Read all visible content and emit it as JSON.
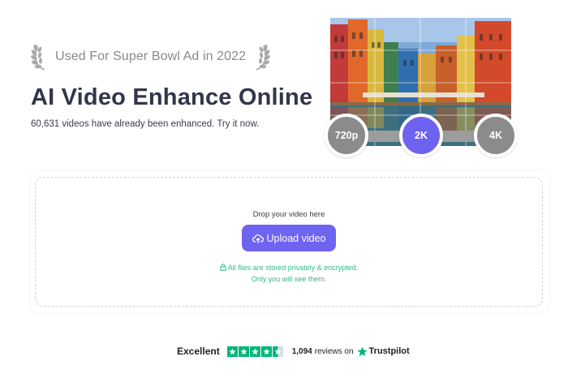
{
  "award": {
    "text": "Used For Super Bowl Ad in 2022",
    "icons": [
      "laurel-left-icon",
      "laurel-right-icon"
    ]
  },
  "hero": {
    "title": "AI Video Enhance Online",
    "subtitle": "60,631 videos have already been enhanced. Try it now."
  },
  "resolution": {
    "options": [
      "720p",
      "2K",
      "4K"
    ],
    "selected": "2K",
    "colors": {
      "selected": "#6d63f0",
      "unselected": "#8b8b8b"
    }
  },
  "upload": {
    "drop_text": "Drop your video here",
    "button_label": "Upload video",
    "button_icon": "cloud-upload-icon",
    "privacy_line1": "All files are stored privately & encrypted.",
    "privacy_line2": "Only you will see them.",
    "privacy_icon": "lock-icon",
    "colors": {
      "button": "#6f63f1",
      "privacy_text": "#2fbb8d"
    }
  },
  "reviews": {
    "rating_word": "Excellent",
    "stars": 4.5,
    "count": "1,094",
    "on_text": "reviews on",
    "brand": "Trustpilot",
    "colors": {
      "star": "#00b67a"
    }
  }
}
